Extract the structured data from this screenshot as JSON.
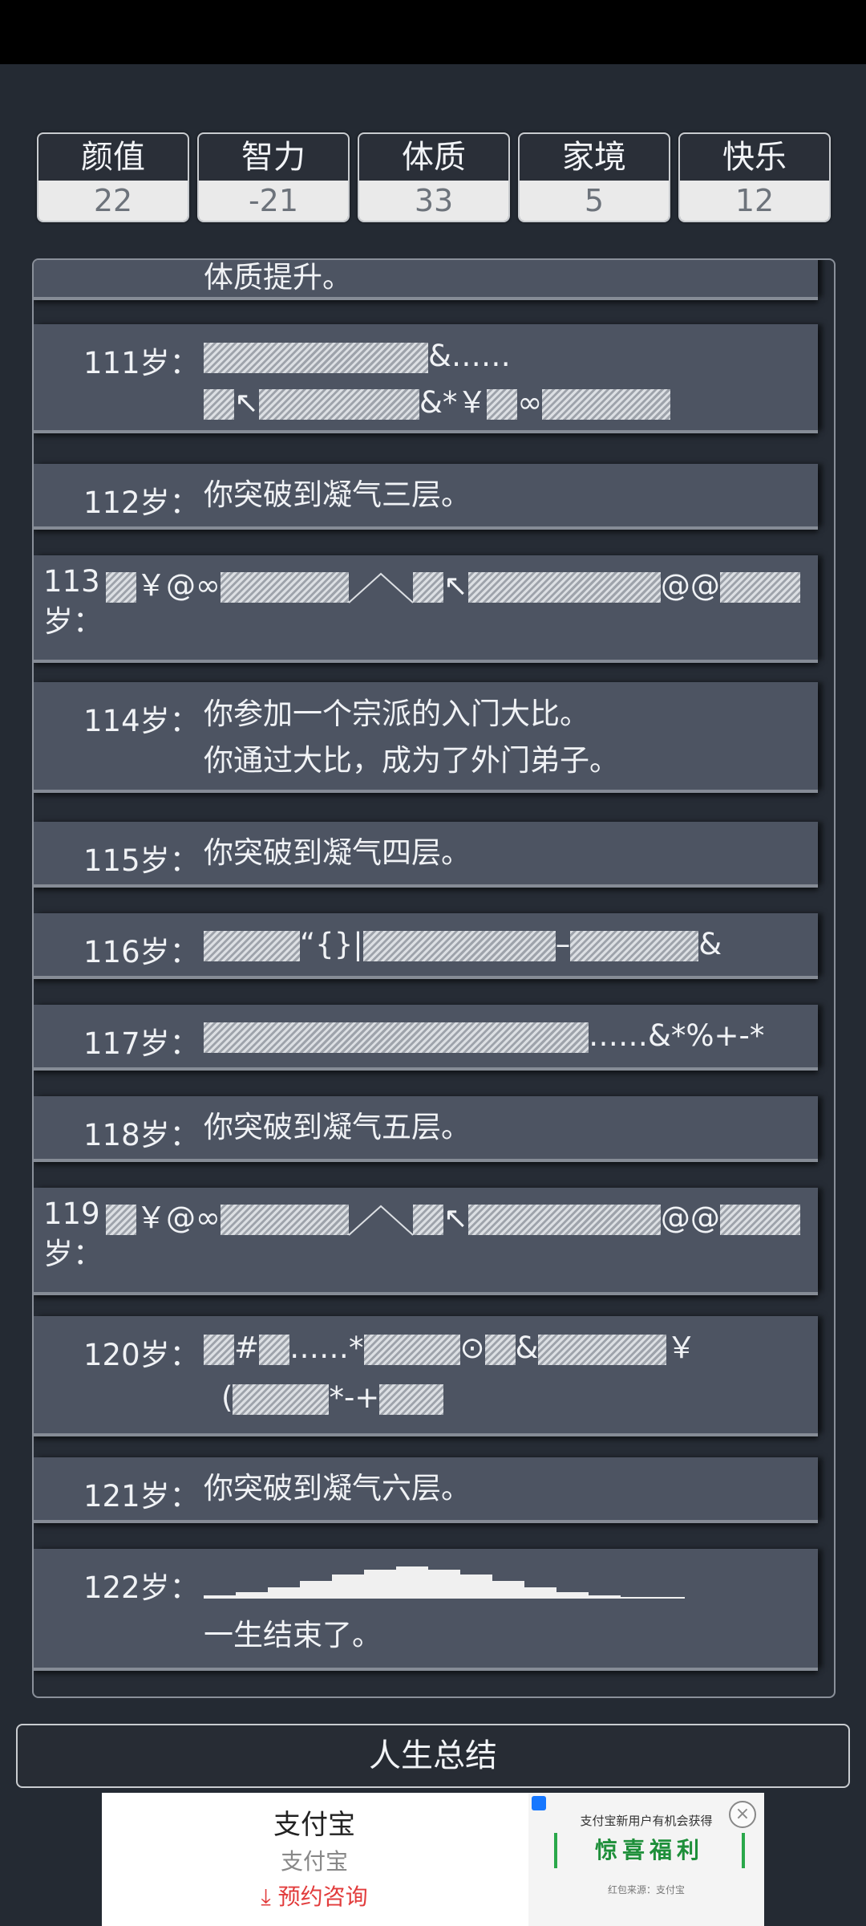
{
  "attributes": [
    {
      "name": "颜值",
      "value": "22"
    },
    {
      "name": "智力",
      "value": "-21"
    },
    {
      "name": "体质",
      "value": "33"
    },
    {
      "name": "家境",
      "value": "5"
    },
    {
      "name": "快乐",
      "value": "12"
    }
  ],
  "timeline": {
    "partial_top": "体质提升。",
    "r111": {
      "age": "111岁：",
      "l1": "&……",
      "l2a": "↖",
      "l2b": "&*￥",
      "l2c": "∞"
    },
    "r112": {
      "age": "112岁：",
      "text": "你突破到凝气三层。"
    },
    "r113": {
      "age": "113岁：",
      "a": "￥@∞",
      "b": "↖",
      "c": "@@"
    },
    "r114": {
      "age": "114岁：",
      "l1": "你参加一个宗派的入门大比。",
      "l2": "你通过大比，成为了外门弟子。"
    },
    "r115": {
      "age": "115岁：",
      "text": "你突破到凝气四层。"
    },
    "r116": {
      "age": "116岁：",
      "a": "“{}|",
      "b": "–",
      "c": "&"
    },
    "r117": {
      "age": "117岁：",
      "a": "……&*%+-*"
    },
    "r118": {
      "age": "118岁：",
      "text": "你突破到凝气五层。"
    },
    "r119": {
      "age": "119岁：",
      "a": "￥@∞",
      "b": "↖",
      "c": "@@"
    },
    "r120": {
      "age": "120岁：",
      "a": "#",
      "b": "……*",
      "c": "⊙",
      "d": "&",
      "e": "￥",
      "f": "(",
      "g": "*-+"
    },
    "r121": {
      "age": "121岁：",
      "text": "你突破到凝气六层。"
    },
    "r122": {
      "age": "122岁：",
      "l2": "一生结束了。"
    }
  },
  "summary_button": "人生总结",
  "ad": {
    "title": "支付宝",
    "subtitle": "支付宝",
    "cta": "预约咨询",
    "banner_line1": "支付宝新用户有机会获得",
    "banner_headline": "惊喜福利",
    "banner_source": "红包来源：支付宝"
  }
}
